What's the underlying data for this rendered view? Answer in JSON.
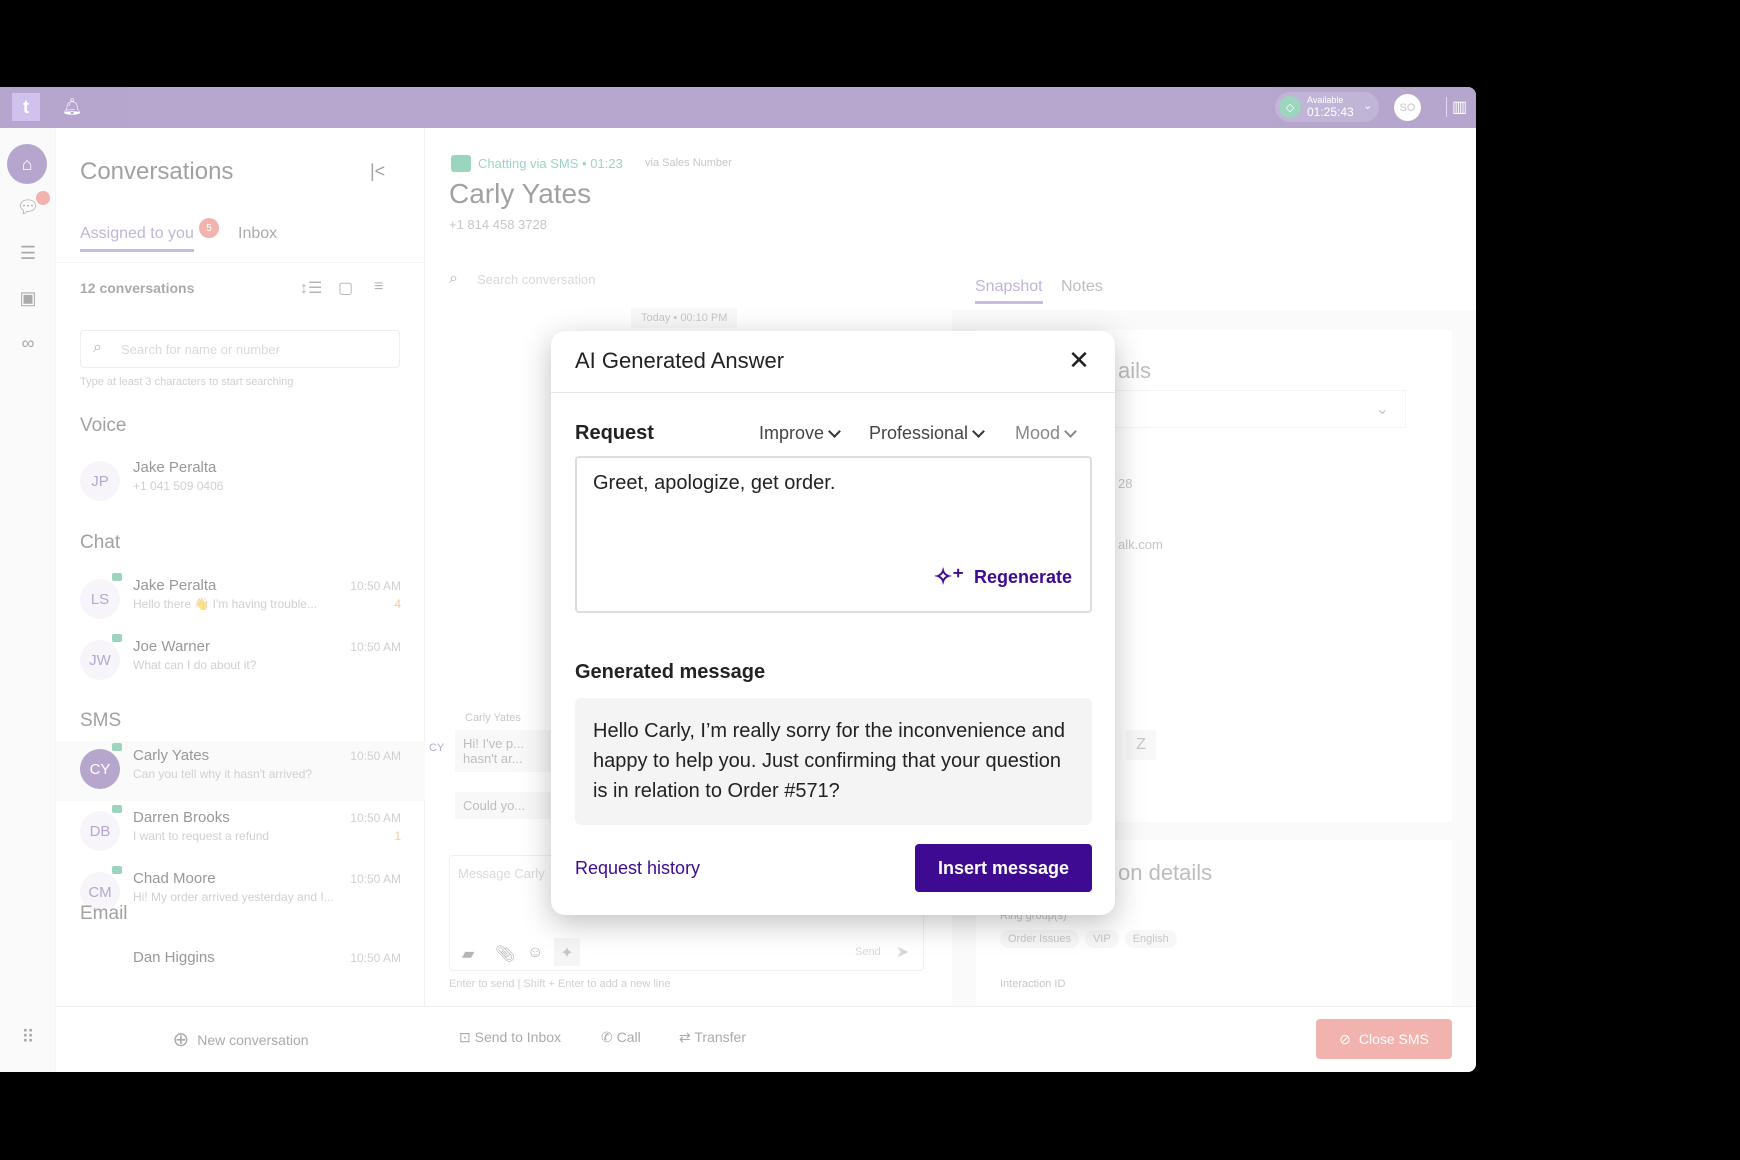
{
  "topbar": {
    "logo": "t",
    "status_label": "Available",
    "status_timer": "01:25:43",
    "user_initials": "SO"
  },
  "conversations": {
    "title": "Conversations",
    "tabs": [
      {
        "label": "Assigned to you",
        "badge": "5"
      },
      {
        "label": "Inbox"
      }
    ],
    "count": "12 conversations",
    "search_placeholder": "Search for name or number",
    "search_hint": "Type at least 3 characters to start searching",
    "sections": {
      "voice": "Voice",
      "chat": "Chat",
      "sms": "SMS",
      "email": "Email"
    },
    "voice_items": [
      {
        "initials": "JP",
        "name": "Jake Peralta",
        "preview": "+1 041 509 0406"
      }
    ],
    "chat_items": [
      {
        "initials": "LS",
        "name": "Jake Peralta",
        "preview": "Hello there 👋 I'm having trouble...",
        "time": "10:50 AM",
        "count": "4"
      },
      {
        "initials": "JW",
        "name": "Joe Warner",
        "preview": "What can I do about it?",
        "time": "10:50 AM"
      }
    ],
    "sms_items": [
      {
        "initials": "CY",
        "name": "Carly Yates",
        "preview": "Can you tell why it hasn't arrived?",
        "time": "10:50 AM"
      },
      {
        "initials": "DB",
        "name": "Darren Brooks",
        "preview": "I want to request a refund",
        "time": "10:50 AM",
        "count": "1"
      },
      {
        "initials": "CM",
        "name": "Chad Moore",
        "preview": "Hi! My order arrived yesterday and I...",
        "time": "10:50 AM"
      }
    ],
    "email_items": [
      {
        "name": "Dan Higgins",
        "time": "10:50 AM"
      }
    ],
    "new_conversation": "New conversation"
  },
  "chat": {
    "channel": "Chatting via SMS • 01:23",
    "via": "via Sales Number",
    "contact_name": "Carly Yates",
    "phone": "+1 814 458 3728",
    "search_placeholder": "Search conversation",
    "date_pill": "Today • 00:10 PM",
    "sender": "Carly Yates",
    "sender_initials": "CY",
    "bubble1": "Hi! I've p... hasn't ar...",
    "bubble2": "Could yo...",
    "input_placeholder": "Message Carly",
    "send": "Send",
    "hint": "Enter to send | Shift + Enter to add a new line"
  },
  "right": {
    "tabs": [
      "Snapshot",
      "Notes"
    ],
    "card_title_partial": "ails",
    "phone_partial": "28",
    "email_partial": "alk.com",
    "details_partial": "on details",
    "ring_groups_label": "Ring group(s)",
    "ring_groups": [
      "Order Issues",
      "VIP",
      "English"
    ],
    "interaction_label": "Interaction ID"
  },
  "bottom": {
    "send_to_inbox": "Send to Inbox",
    "call": "Call",
    "transfer": "Transfer",
    "close": "Close SMS"
  },
  "modal": {
    "title": "AI Generated Answer",
    "request_label": "Request",
    "dropdowns": [
      "Improve",
      "Professional",
      "Mood"
    ],
    "request_text": "Greet, apologize, get order.",
    "regenerate": "Regenerate",
    "generated_label": "Generated message",
    "generated_text": "Hello Carly, I’m really sorry for the inconvenience and happy to help you. Just confirming that your question is in relation to Order #571?",
    "history": "Request history",
    "insert": "Insert message"
  },
  "colors": {
    "brand": "#7b5ea7",
    "primary": "#3d0a91",
    "close": "#e8766c",
    "sms": "#4db38a"
  }
}
